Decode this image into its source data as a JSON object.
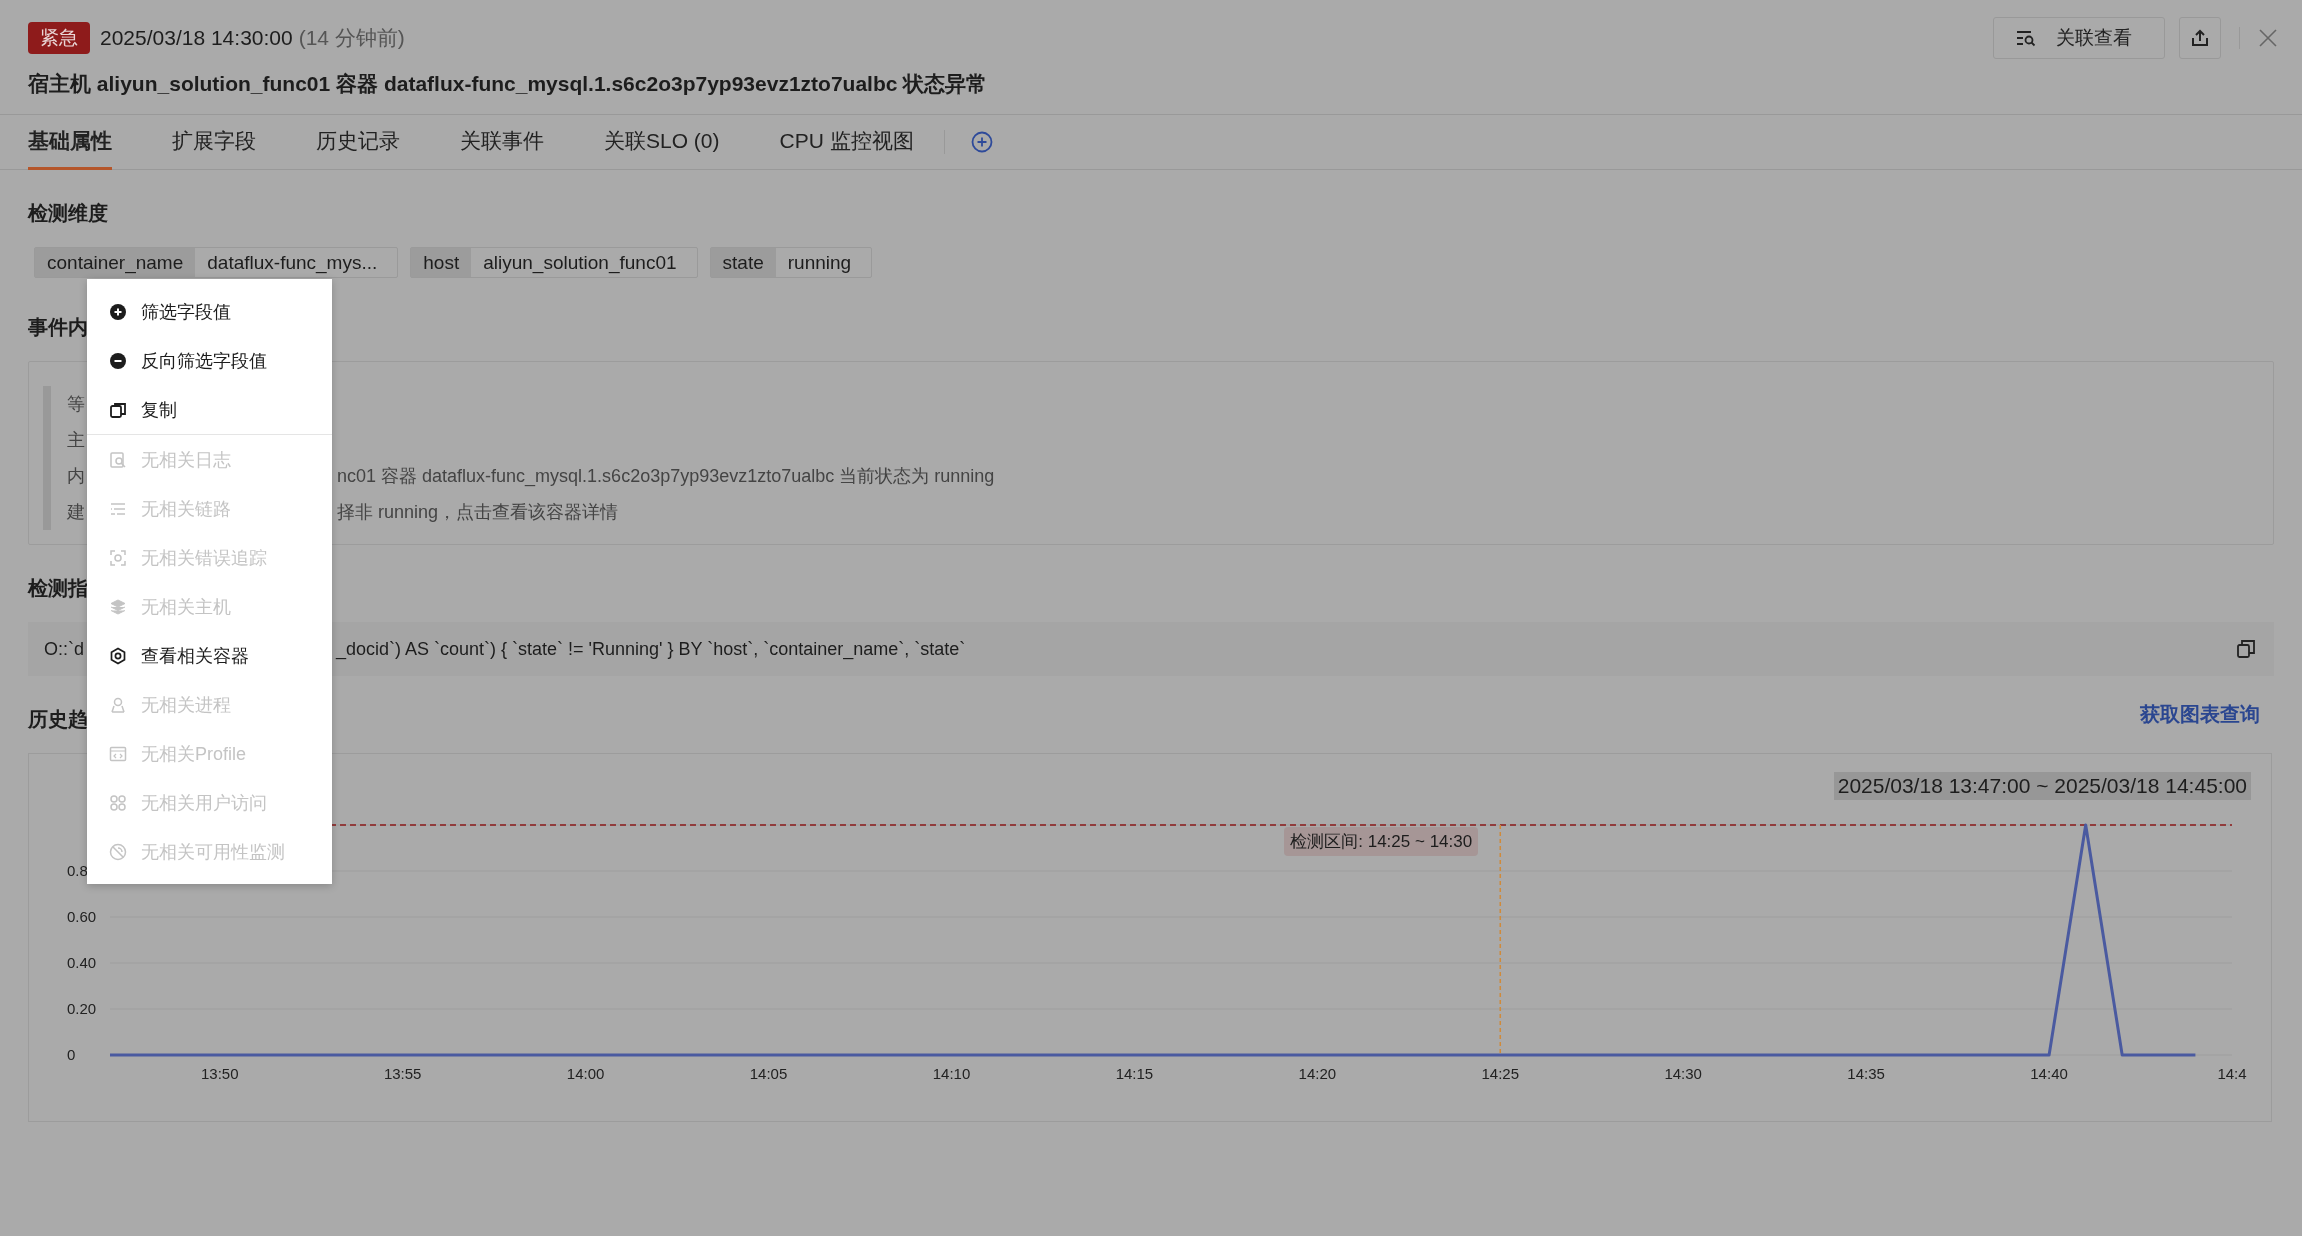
{
  "alert": {
    "level": "紧急",
    "time": "2025/03/18 14:30:00",
    "ago": "(14 分钟前)",
    "title": "宿主机 aliyun_solution_func01 容器 dataflux-func_mysql.1.s6c2o3p7yp93evz1zto7ualbc 状态异常"
  },
  "actions": {
    "related_button": "关联查看"
  },
  "tabs": [
    {
      "label": "基础属性",
      "selected": true
    },
    {
      "label": "扩展字段",
      "selected": false
    },
    {
      "label": "历史记录",
      "selected": false
    },
    {
      "label": "关联事件",
      "selected": false
    },
    {
      "label": "关联SLO (0)",
      "selected": false
    },
    {
      "label": "CPU 监控视图",
      "selected": false
    }
  ],
  "dimensions": {
    "title": "检测维度",
    "tags": [
      {
        "key": "container_name",
        "value": "dataflux-func_mys..."
      },
      {
        "key": "host",
        "value": "aliyun_solution_func01"
      },
      {
        "key": "state",
        "value": "running"
      }
    ]
  },
  "event_content": {
    "title": "事件内",
    "rows": [
      {
        "label": "等"
      },
      {
        "label": "主"
      },
      {
        "label": "内",
        "value": "nc01 容器 dataflux-func_mysql.1.s6c2o3p7yp93evz1zto7ualbc 当前状态为 running"
      },
      {
        "label": "建",
        "value": "择非 running，点击查看该容器详情"
      }
    ]
  },
  "query": {
    "title": "检测指",
    "text_left": "O::`d",
    "text_right": "_docid`) AS `count`) { `state` != 'Running' } BY `host`, `container_name`, `state`"
  },
  "history": {
    "title": "历史趋",
    "link": "获取图表查询",
    "range": "2025/03/18 13:47:00 ~ 2025/03/18 14:45:00",
    "chart_data": {
      "type": "line",
      "x": [
        827,
        828,
        829,
        830,
        831,
        832,
        833,
        834,
        835,
        836,
        837,
        838,
        839,
        840,
        841,
        842,
        843,
        844,
        845,
        846,
        847,
        848,
        849,
        850,
        851,
        852,
        853,
        854,
        855,
        856,
        857,
        858,
        859,
        860,
        861,
        862,
        863,
        864,
        865,
        866,
        867,
        868,
        869,
        870,
        871,
        872,
        873,
        874,
        875,
        876,
        877,
        878,
        879,
        880,
        881,
        882,
        883,
        884
      ],
      "series": [
        {
          "color": "#4a5aa0",
          "values": [
            0,
            0,
            0,
            0,
            0,
            0,
            0,
            0,
            0,
            0,
            0,
            0,
            0,
            0,
            0,
            0,
            0,
            0,
            0,
            0,
            0,
            0,
            0,
            0,
            0,
            0,
            0,
            0,
            0,
            0,
            0,
            0,
            0,
            0,
            0,
            0,
            0,
            0,
            0,
            0,
            0,
            0,
            0,
            0,
            0,
            0,
            0,
            0,
            0,
            0,
            0,
            0,
            0,
            0,
            1,
            0,
            0,
            0
          ]
        }
      ],
      "xlim": [
        827,
        885
      ],
      "ylim": [
        0,
        1
      ],
      "grid": true,
      "xticks": [
        {
          "value": 830,
          "label": "13:50"
        },
        {
          "value": 835,
          "label": "13:55"
        },
        {
          "value": 840,
          "label": "14:00"
        },
        {
          "value": 845,
          "label": "14:05"
        },
        {
          "value": 850,
          "label": "14:10"
        },
        {
          "value": 855,
          "label": "14:15"
        },
        {
          "value": 860,
          "label": "14:20"
        },
        {
          "value": 865,
          "label": "14:25"
        },
        {
          "value": 870,
          "label": "14:30"
        },
        {
          "value": 875,
          "label": "14:35"
        },
        {
          "value": 880,
          "label": "14:40"
        },
        {
          "value": 885,
          "label": "14:4"
        }
      ],
      "yticks": [
        {
          "value": 0,
          "label": "0"
        },
        {
          "value": 0.2,
          "label": "0.20"
        },
        {
          "value": 0.4,
          "label": "0.40"
        },
        {
          "value": 0.6,
          "label": "0.60"
        },
        {
          "value": 0.8,
          "label": "0.8"
        }
      ],
      "ref_lines": [
        {
          "axis": "y",
          "value": 1,
          "color": "#8b1a1a"
        },
        {
          "axis": "x",
          "value": 865,
          "color": "#d08a3a"
        }
      ]
    },
    "detection_label": "检测区间: 14:25 ~ 14:30"
  },
  "context_menu": {
    "groups": [
      [
        {
          "label": "筛选字段值",
          "disabled": false
        },
        {
          "label": "反向筛选字段值",
          "disabled": false
        },
        {
          "label": "复制",
          "disabled": false
        }
      ],
      [
        {
          "label": "无相关日志",
          "disabled": true
        },
        {
          "label": "无相关链路",
          "disabled": true
        },
        {
          "label": "无相关错误追踪",
          "disabled": true
        },
        {
          "label": "无相关主机",
          "disabled": true
        },
        {
          "label": "查看相关容器",
          "disabled": false
        },
        {
          "label": "无相关进程",
          "disabled": true
        },
        {
          "label": "无相关Profile",
          "disabled": true
        },
        {
          "label": "无相关用户访问",
          "disabled": true
        },
        {
          "label": "无相关可用性监测",
          "disabled": true
        }
      ]
    ]
  }
}
